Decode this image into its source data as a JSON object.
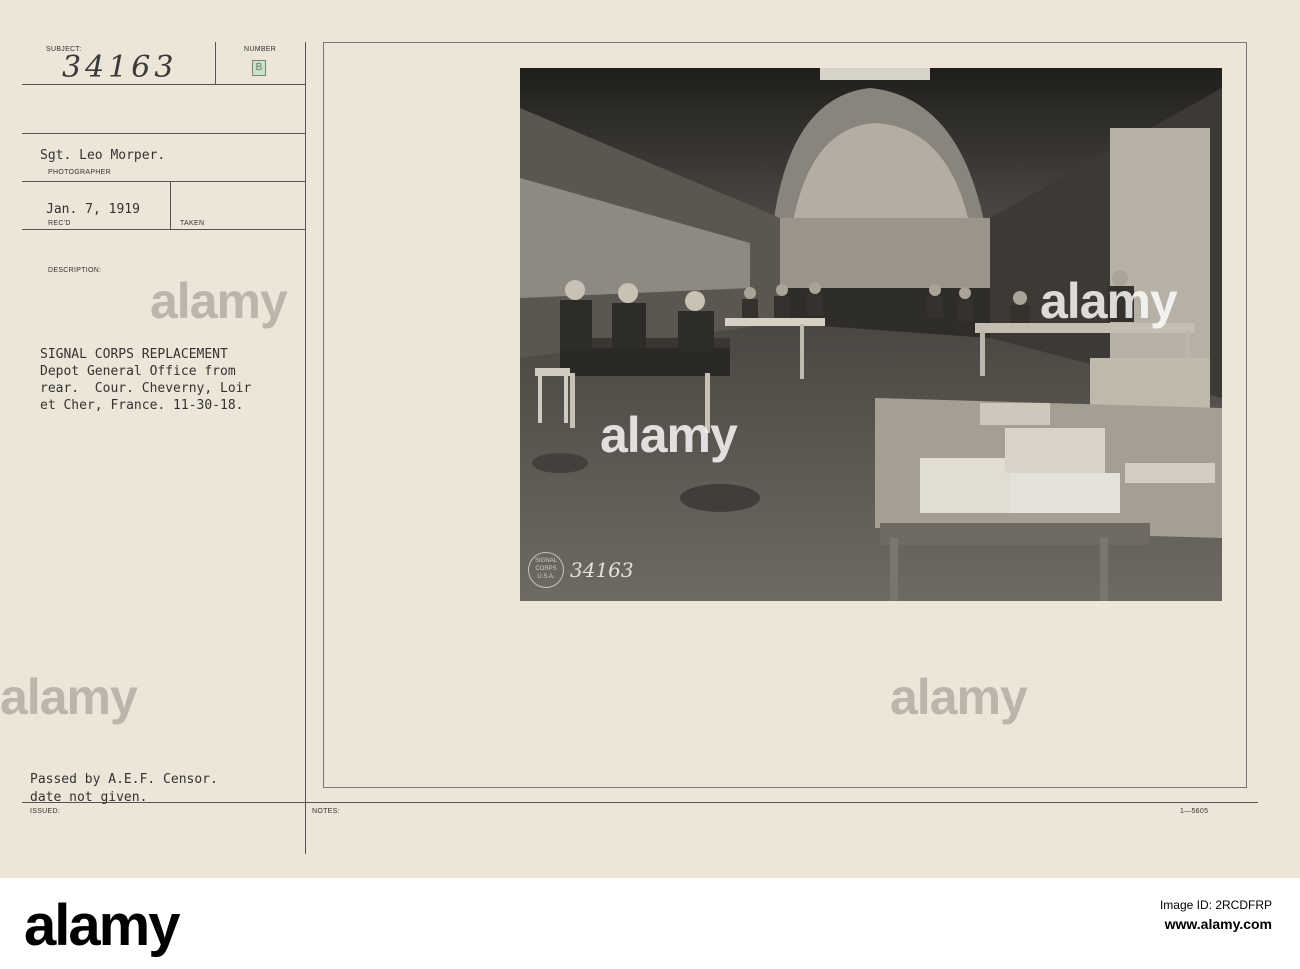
{
  "card": {
    "subject_label": "SUBJECT:",
    "subject_number": "34163",
    "number_label": "NUMBER",
    "number_value": "B",
    "photographer_name": "Sgt. Leo Morper.",
    "photographer_label": "PHOTOGRAPHER",
    "received_date": "Jan. 7, 1919",
    "received_label": "REC'D",
    "taken_label": "TAKEN",
    "description_label": "DESCRIPTION:",
    "description_lines": [
      "SIGNAL CORPS REPLACEMENT",
      "Depot General Office from",
      "rear.  Cour. Cheverny, Loir",
      "et Cher, France. 11-30-18."
    ],
    "censor_line_1": "Passed by A.E.F. Censor.",
    "censor_line_2": "date not given.",
    "issued_label": "ISSUED:",
    "notes_label": "NOTES:",
    "form_number": "1—5605"
  },
  "photo": {
    "stamp_text": "SIGNAL CORPS U.S.A.",
    "handwritten_number": "34163"
  },
  "watermarks": [
    "alamy",
    "alamy",
    "alamy",
    "alamy",
    "alamy"
  ],
  "banner": {
    "logo": "alamy",
    "image_id": "Image ID: 2RCDFRP",
    "url": "www.alamy.com"
  }
}
